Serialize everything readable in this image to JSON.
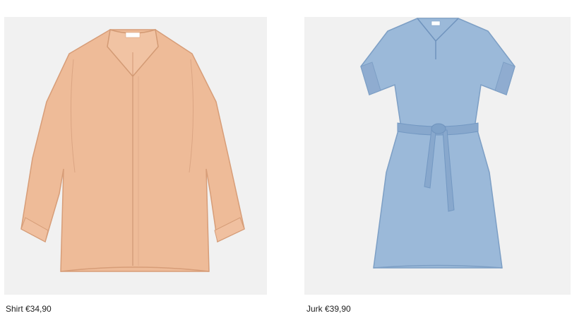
{
  "products": [
    {
      "name": "Shirt",
      "price": "€34,90",
      "caption": "Shirt €34,90",
      "image": "peach-linen-shirt",
      "color": "#eebb98"
    },
    {
      "name": "Jurk",
      "price": "€39,90",
      "caption": "Jurk €39,90",
      "image": "chambray-belted-dress",
      "color": "#9bb9d9"
    }
  ]
}
